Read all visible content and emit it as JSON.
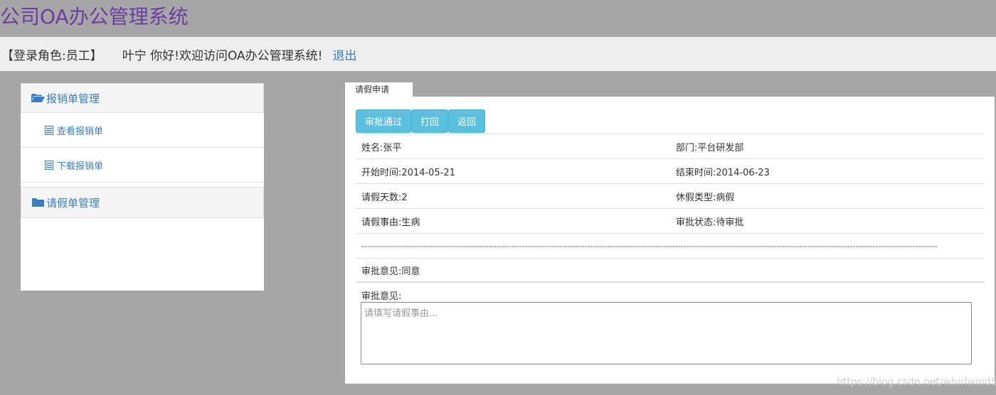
{
  "app": {
    "title": "公司OA办公管理系统"
  },
  "userbar": {
    "role": "【登录角色:员工】",
    "welcome": "叶宁 你好!欢迎访问OA办公管理系统!",
    "logout": "退出"
  },
  "sidebar": {
    "groups": [
      {
        "label": "报销单管理",
        "icon": "folder-open-icon",
        "items": [
          {
            "label": "查看报销单",
            "icon": "list-icon"
          },
          {
            "label": "下载报销单",
            "icon": "list-icon"
          }
        ]
      },
      {
        "label": "请假单管理",
        "icon": "folder-icon",
        "items": []
      }
    ]
  },
  "tab": {
    "label": "请假申请"
  },
  "buttons": {
    "approve": "审批通过",
    "reject": "打回",
    "back": "返回"
  },
  "details": {
    "name": "姓名:张平",
    "dept": "部门:平台研发部",
    "start": "开始时间:2014-05-21",
    "end": "结束时间:2014-06-23",
    "days": "请假天数:2",
    "type": "休假类型:病假",
    "reason": "请假事由:生病",
    "status": "审批状态:待审批",
    "divider": "------------------------------------------------------------------------------------------------------------------------------------------------------------------------------------------------------------",
    "previous_opinion": "审批意见:同意"
  },
  "form": {
    "opinion_label": "审批意见:",
    "opinion_placeholder": "请填写请假事由..."
  },
  "watermark": "https://blog.csdn.net/whirlwind526",
  "colors": {
    "accent": "#3a7fc1",
    "button": "#5bc0de",
    "title": "#6a3fa0",
    "background": "#a6a6a6"
  }
}
